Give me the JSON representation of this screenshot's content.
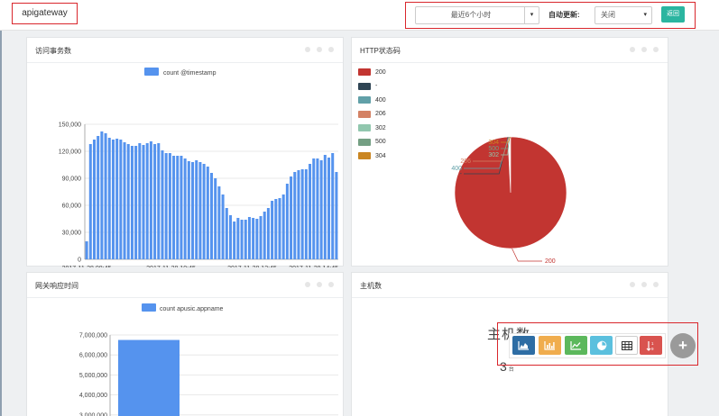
{
  "header": {
    "app_title": "apigateway",
    "time_range": "最近6个小时",
    "auto_refresh_label": "自动更新:",
    "auto_refresh_value": "关闭",
    "back_label": "返回"
  },
  "panels": {
    "requests": {
      "title": "访问事务数",
      "legend": "count @timestamp",
      "color": "#5593ee"
    },
    "http_status": {
      "title": "HTTP状态码",
      "legend": [
        {
          "label": "200",
          "color": "#c23531"
        },
        {
          "label": "-",
          "color": "#2f4554"
        },
        {
          "label": "400",
          "color": "#61a0a8"
        },
        {
          "label": "206",
          "color": "#d48265"
        },
        {
          "label": "302",
          "color": "#91c7ae"
        },
        {
          "label": "500",
          "color": "#749f83"
        },
        {
          "label": "304",
          "color": "#ca8622"
        }
      ]
    },
    "response_time": {
      "title": "网关响应时间",
      "legend": "count apusic.appname",
      "color": "#5593ee"
    },
    "hosts": {
      "title": "主机数",
      "stat_title": "主机数",
      "stat_value": "3",
      "stat_unit": "台"
    }
  },
  "toolbar": {
    "icons": [
      "area-chart-icon",
      "bar-chart-icon",
      "line-chart-icon",
      "pie-chart-icon",
      "table-icon",
      "sort-icon"
    ],
    "colors": [
      "#2e6da4",
      "#f0ad4e",
      "#5cb85c",
      "#5bc0de",
      "#ffffff",
      "#d9534f"
    ]
  },
  "chart_data": [
    {
      "type": "bar",
      "legend": [
        "count @timestamp"
      ],
      "x_tick_labels": [
        "2017-11-28 08:45",
        "2017-11-28 10:45",
        "2017-11-28 12:45",
        "2017-11-28 14:45"
      ],
      "y_tick_labels": [
        "0",
        "30,000",
        "60,000",
        "90,000",
        "120,000",
        "150,000"
      ],
      "ylim": [
        0,
        150000
      ],
      "grid": true,
      "series": [
        {
          "name": "count @timestamp",
          "values": [
            20000,
            128000,
            133000,
            137000,
            142000,
            140000,
            135000,
            133000,
            134000,
            133000,
            130000,
            128000,
            126000,
            126000,
            129000,
            127000,
            129000,
            131000,
            128000,
            129000,
            121000,
            118000,
            118000,
            115000,
            115000,
            115000,
            112000,
            109000,
            108000,
            110000,
            108000,
            106000,
            103000,
            96000,
            90000,
            81000,
            72000,
            57000,
            49000,
            42000,
            46000,
            44000,
            44000,
            47000,
            46000,
            45000,
            48000,
            53000,
            57000,
            65000,
            67000,
            68000,
            72000,
            84000,
            92000,
            97000,
            99000,
            100000,
            100000,
            106000,
            112000,
            112000,
            110000,
            116000,
            113000,
            118000,
            97000
          ]
        }
      ]
    },
    {
      "type": "pie",
      "legend": [
        "200",
        "-",
        "400",
        "206",
        "302",
        "500",
        "304"
      ],
      "legend_position": "top-left",
      "slices": [
        {
          "label": "200",
          "value": 99.2
        },
        {
          "label": "-",
          "value": 0.1
        },
        {
          "label": "400",
          "value": 0.15
        },
        {
          "label": "206",
          "value": 0.15
        },
        {
          "label": "302",
          "value": 0.1
        },
        {
          "label": "500",
          "value": 0.1
        },
        {
          "label": "304",
          "value": 0.2
        }
      ]
    },
    {
      "type": "bar",
      "legend": [
        "count apusic.appname"
      ],
      "y_tick_labels": [
        "3,000,000",
        "4,000,000",
        "5,000,000",
        "6,000,000",
        "7,000,000"
      ],
      "ylim": [
        3000000,
        7000000
      ],
      "grid": true,
      "series": [
        {
          "name": "count apusic.appname",
          "values": [
            6750000
          ]
        }
      ]
    }
  ]
}
